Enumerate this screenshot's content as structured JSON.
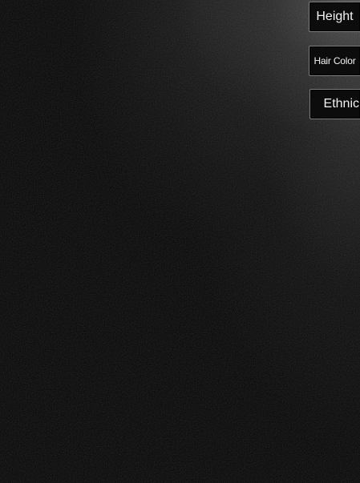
{
  "filters": {
    "height_label": "Height",
    "hair_color_label": "Hair Color",
    "ethnicity_label": "Ethnic"
  },
  "colors": {
    "background": "#000000",
    "button_background": "#0c0c0c",
    "button_border": "#7a7a7a",
    "button_text": "#f2f2f2"
  }
}
